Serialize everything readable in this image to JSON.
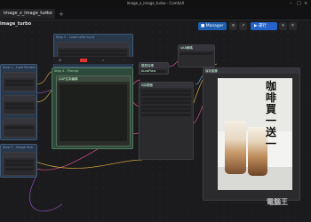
{
  "window": {
    "title": "image_z_image_turbo - ComfyUI"
  },
  "tabs": [
    {
      "label": "image_z_image_turbo"
    }
  ],
  "workflow": {
    "name": "image_turbo"
  },
  "toolbar": {
    "manager_label": "Manager",
    "run_label": "運行"
  },
  "nodes": {
    "group_top_label": "Step 2 - Load LoRA input",
    "group_left_label": "Step 1 - Load Models",
    "group_left_bottom_label": "Step 3 - Image Size",
    "group_center_label": "Step 4 - Prompt",
    "prompt_node_label": "CLIP文本編碼",
    "sampler_label": "K採樣器",
    "save_label": "保存圖像",
    "model_sampling_label": "模型採樣 AuraFlow",
    "vae_label": "VAE解碼"
  },
  "preview": {
    "overlay_text": "咖啡買一送一"
  },
  "watermark": {
    "text": "電腦王"
  }
}
